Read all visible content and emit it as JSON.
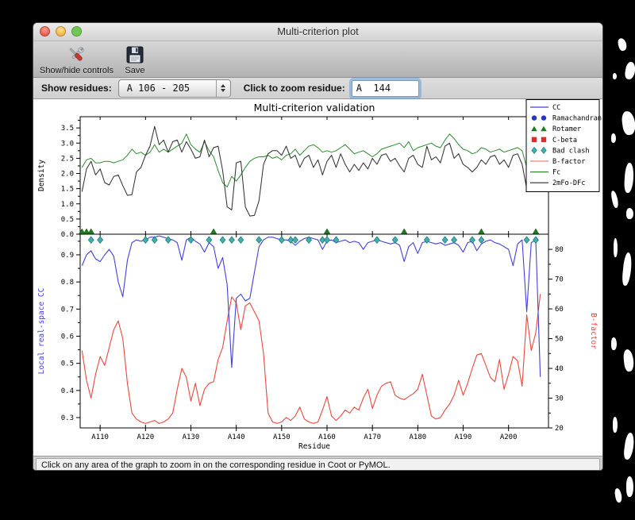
{
  "window": {
    "title": "Multi-criterion plot"
  },
  "toolbar": {
    "buttons": [
      {
        "label": "Show/hide controls",
        "icon": "tools-icon"
      },
      {
        "label": "Save",
        "icon": "floppy-disk-icon"
      }
    ]
  },
  "controls": {
    "show_residues_label": "Show residues:",
    "show_residues_value": "A 106 - 205",
    "zoom_residue_label": "Click to zoom residue:",
    "zoom_residue_value": "A  144"
  },
  "status_bar": {
    "text": "Click on any area of the graph to zoom in on the corresponding residue in Coot or PyMOL."
  },
  "chart_data": {
    "type": "line",
    "title": "Multi-criterion validation",
    "x": {
      "label": "Residue",
      "range": [
        105.6,
        208.8
      ],
      "ticks": [
        {
          "v": 110,
          "label": "A110"
        },
        {
          "v": 120,
          "label": "A120"
        },
        {
          "v": 130,
          "label": "A130"
        },
        {
          "v": 140,
          "label": "A140"
        },
        {
          "v": 150,
          "label": "A150"
        },
        {
          "v": 160,
          "label": "A160"
        },
        {
          "v": 170,
          "label": "A170"
        },
        {
          "v": 180,
          "label": "A180"
        },
        {
          "v": 190,
          "label": "A190"
        },
        {
          "v": 200,
          "label": "A200"
        }
      ]
    },
    "residues": [
      106,
      107,
      108,
      109,
      110,
      111,
      112,
      113,
      114,
      115,
      116,
      117,
      118,
      119,
      120,
      121,
      122,
      123,
      124,
      125,
      126,
      127,
      128,
      129,
      130,
      131,
      132,
      133,
      134,
      135,
      136,
      137,
      138,
      139,
      140,
      141,
      142,
      143,
      144,
      145,
      146,
      147,
      148,
      149,
      150,
      151,
      152,
      153,
      154,
      155,
      156,
      157,
      158,
      159,
      160,
      161,
      162,
      163,
      164,
      165,
      166,
      167,
      168,
      169,
      170,
      171,
      172,
      173,
      174,
      175,
      176,
      177,
      178,
      179,
      180,
      181,
      182,
      183,
      184,
      185,
      186,
      187,
      188,
      189,
      190,
      191,
      192,
      193,
      194,
      195,
      196,
      197,
      198,
      199,
      200,
      201,
      202,
      203,
      204,
      205,
      206,
      207
    ],
    "top_plot": {
      "ylabel": "Density",
      "ylim": [
        0,
        3.87
      ],
      "yticks": [
        0,
        0.5,
        1.0,
        1.5,
        2.0,
        2.5,
        3.0,
        3.5
      ],
      "series": [
        {
          "name": "Fc",
          "color": "#2e8b2e",
          "values": [
            2.2,
            2.45,
            2.5,
            2.35,
            2.35,
            2.4,
            2.4,
            2.35,
            2.4,
            2.45,
            2.6,
            2.8,
            2.65,
            2.7,
            2.6,
            2.7,
            2.95,
            2.7,
            2.8,
            2.7,
            2.8,
            2.9,
            3.0,
            3.3,
            2.95,
            2.8,
            2.7,
            3.05,
            2.75,
            2.55,
            2.1,
            1.7,
            1.55,
            1.9,
            1.75,
            1.95,
            2.2,
            2.4,
            2.5,
            2.55,
            2.55,
            2.6,
            2.5,
            2.55,
            2.45,
            2.6,
            2.65,
            2.8,
            2.6,
            2.75,
            2.9,
            2.95,
            2.85,
            2.7,
            2.75,
            2.7,
            2.75,
            2.85,
            2.95,
            2.8,
            2.65,
            2.7,
            2.75,
            2.65,
            2.55,
            2.65,
            2.8,
            2.85,
            2.9,
            2.95,
            3.0,
            2.85,
            3.05,
            2.75,
            2.85,
            2.9,
            2.95,
            3.0,
            2.9,
            2.85,
            3.1,
            3.3,
            3.15,
            2.95,
            2.8,
            2.75,
            2.65,
            2.7,
            2.85,
            2.8,
            2.7,
            2.75,
            2.8,
            2.7,
            2.75,
            2.8,
            2.85,
            2.75,
            2.2,
            2.1,
            2.55,
            2.6
          ]
        },
        {
          "name": "2mFo-DFc",
          "color": "#2b2b2b",
          "values": [
            1.4,
            2.15,
            2.4,
            1.95,
            2.15,
            1.7,
            1.62,
            1.9,
            1.95,
            1.6,
            1.28,
            1.3,
            2.05,
            2.2,
            2.6,
            2.9,
            3.55,
            2.95,
            3.1,
            2.7,
            3.05,
            3.1,
            2.7,
            3.05,
            2.8,
            2.5,
            2.55,
            3.1,
            2.55,
            2.85,
            2.9,
            2.1,
            0.9,
            0.8,
            2.35,
            2.4,
            0.9,
            0.6,
            0.62,
            1.1,
            2.3,
            2.65,
            2.75,
            2.75,
            2.6,
            2.9,
            2.5,
            2.6,
            2.2,
            2.5,
            2.6,
            2.2,
            2.45,
            1.95,
            2.4,
            2.6,
            2.2,
            2.65,
            2.3,
            2.05,
            2.3,
            2.1,
            2.35,
            2.15,
            2.5,
            2.3,
            2.6,
            2.65,
            2.4,
            2.5,
            2.25,
            2.05,
            2.5,
            2.6,
            2.3,
            2.2,
            2.9,
            2.45,
            2.55,
            2.35,
            2.9,
            3.0,
            2.5,
            2.65,
            2.3,
            2.2,
            2.05,
            2.2,
            2.45,
            2.3,
            2.55,
            2.6,
            2.3,
            2.45,
            2.2,
            2.6,
            2.65,
            2.3,
            1.5,
            2.0,
            1.95,
            1.4
          ]
        }
      ]
    },
    "bottom_plot": {
      "ylabel_left": "Local real-space CC",
      "ylabel_left_color": "#4040dd",
      "ylim_left": [
        0.262,
        0.976
      ],
      "yticks_left": [
        0.3,
        0.4,
        0.5,
        0.6,
        0.7,
        0.8,
        0.9
      ],
      "ylabel_right": "B-factor",
      "ylabel_right_color": "#e8483e",
      "ylim_right": [
        20,
        85.1
      ],
      "yticks_right": [
        20,
        30,
        40,
        50,
        60,
        70,
        80
      ],
      "series": [
        {
          "name": "CC",
          "axis": "left",
          "color": "#4040dd",
          "values": [
            0.86,
            0.9,
            0.915,
            0.885,
            0.875,
            0.9,
            0.92,
            0.895,
            0.8,
            0.745,
            0.88,
            0.945,
            0.955,
            0.95,
            0.955,
            0.965,
            0.965,
            0.97,
            0.965,
            0.96,
            0.955,
            0.945,
            0.88,
            0.955,
            0.965,
            0.95,
            0.94,
            0.91,
            0.945,
            0.93,
            0.85,
            0.89,
            0.79,
            0.485,
            0.74,
            0.755,
            0.73,
            0.74,
            0.835,
            0.93,
            0.955,
            0.965,
            0.965,
            0.96,
            0.955,
            0.955,
            0.95,
            0.935,
            0.95,
            0.96,
            0.965,
            0.96,
            0.955,
            0.92,
            0.95,
            0.955,
            0.945,
            0.95,
            0.955,
            0.945,
            0.95,
            0.945,
            0.92,
            0.945,
            0.95,
            0.955,
            0.95,
            0.945,
            0.94,
            0.945,
            0.935,
            0.875,
            0.93,
            0.945,
            0.905,
            0.945,
            0.95,
            0.945,
            0.94,
            0.945,
            0.935,
            0.94,
            0.945,
            0.935,
            0.91,
            0.945,
            0.95,
            0.915,
            0.94,
            0.95,
            0.955,
            0.945,
            0.94,
            0.93,
            0.92,
            0.86,
            0.94,
            0.955,
            0.69,
            0.945,
            0.955,
            0.45
          ]
        },
        {
          "name": "B-factor",
          "axis": "right",
          "color": "#e8483e",
          "values": [
            46,
            36,
            30,
            38,
            44,
            41,
            47,
            53,
            56,
            50,
            35,
            25,
            23,
            22,
            21.5,
            22,
            22.5,
            21.5,
            22,
            23,
            25,
            33,
            40,
            37,
            29,
            35,
            27.5,
            33,
            35,
            35.5,
            43,
            47,
            56,
            64,
            62,
            53,
            61,
            62,
            59,
            56,
            45,
            25,
            22,
            21.5,
            22,
            23.5,
            22.5,
            24,
            27,
            23,
            22,
            21.5,
            22,
            26,
            30.5,
            24,
            22.5,
            24,
            26,
            25,
            27,
            26,
            30,
            33,
            26.5,
            31,
            34,
            35,
            35.5,
            31,
            30,
            29.5,
            30.5,
            31.5,
            33,
            38,
            31,
            24,
            23,
            23.5,
            26,
            28,
            31,
            36,
            31,
            35,
            40,
            44.5,
            45,
            41,
            37,
            35.5,
            43,
            33,
            38,
            44,
            42.5,
            34,
            58,
            46,
            52,
            65
          ]
        }
      ],
      "markers": [
        {
          "name": "Rotamer",
          "shape": "triangle",
          "color": "#1e7b1e",
          "residues": [
            106,
            107,
            108,
            135,
            160,
            177,
            194,
            206
          ]
        },
        {
          "name": "Bad clash",
          "shape": "diamond",
          "color": "#3fb0ad",
          "residues": [
            108,
            110,
            120,
            122,
            125,
            130,
            134,
            137,
            139,
            141,
            145,
            150,
            152,
            153,
            156,
            159,
            160,
            162,
            171,
            175,
            182,
            186,
            188,
            192,
            194,
            204,
            206
          ]
        }
      ]
    },
    "legend": [
      {
        "label": "CC",
        "type": "line",
        "color": "#4040dd"
      },
      {
        "label": "Ramachandran",
        "type": "circle",
        "color": "#2433c8"
      },
      {
        "label": "Rotamer",
        "type": "triangle",
        "color": "#1e7b1e"
      },
      {
        "label": "C-beta",
        "type": "square",
        "color": "#d93025"
      },
      {
        "label": "Bad clash",
        "type": "diamond",
        "color": "#3fb0ad"
      },
      {
        "label": "B-factor",
        "type": "line",
        "color": "#f08273"
      },
      {
        "label": "Fc",
        "type": "line",
        "color": "#2e8b2e"
      },
      {
        "label": "2mFo-DFc",
        "type": "line",
        "color": "#2b2b2b"
      }
    ]
  }
}
